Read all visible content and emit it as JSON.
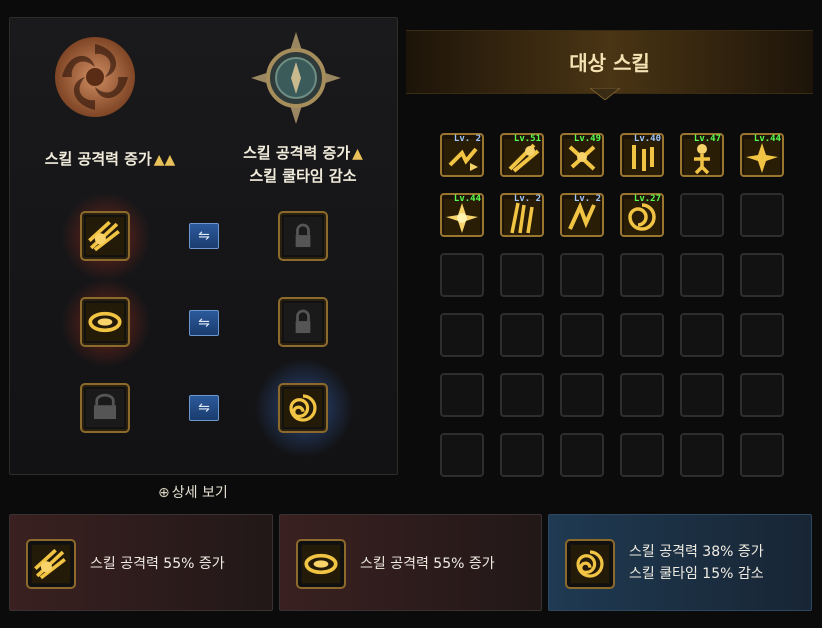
{
  "left_panel": {
    "column_a_label": "스킬 공격력 증가",
    "column_b_label_line1": "스킬 공격력 증가",
    "column_b_label_line2": "스킬 쿨타임 감소",
    "detail_link": "상세 보기",
    "swap_glyph": "⇋"
  },
  "right_panel": {
    "title": "대상 스킬",
    "skills": [
      {
        "level": "Lv. 2",
        "color": "blue"
      },
      {
        "level": "Lv.51",
        "color": "green"
      },
      {
        "level": "Lv.49",
        "color": "green"
      },
      {
        "level": "Lv.40",
        "color": "blue"
      },
      {
        "level": "Lv.47",
        "color": "green"
      },
      {
        "level": "Lv.44",
        "color": "green"
      },
      {
        "level": "Lv.44",
        "color": "green"
      },
      {
        "level": "Lv. 2",
        "color": "blue"
      },
      {
        "level": "Lv. 2",
        "color": "blue"
      },
      {
        "level": "Lv.27",
        "color": "green"
      }
    ]
  },
  "bottom": {
    "card1_text": "스킬 공격력 55% 증가",
    "card2_text": "스킬 공격력 55% 증가",
    "card3_line1": "스킬 공격력 38% 증가",
    "card3_line2": "스킬 쿨타임 15% 감소"
  },
  "colors": {
    "accent_gold": "#c8962e",
    "green_level": "#59ff4f",
    "blue_level": "#9fc6ff"
  }
}
